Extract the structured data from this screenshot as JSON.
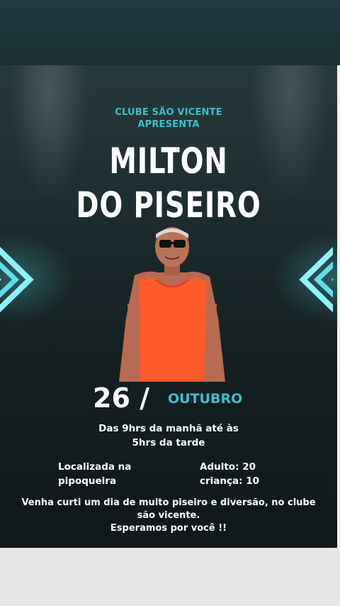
{
  "poster": {
    "presenter_line1": "CLUBE SÃO VICENTE",
    "presenter_line2": "APRESENTA",
    "artist_line1": "MILTON",
    "artist_line2": "DO PISEIRO",
    "date_day": "26 /",
    "date_month": "OUTUBRO",
    "schedule_line1": "Das 9hrs da manhã até às",
    "schedule_line2": "5hrs da tarde",
    "location_line1": "Localizada na",
    "location_line2": "pipoqueira",
    "price_adult": "Adulto: 20",
    "price_child": "criança: 10",
    "invite_line1": "Venha curti um dia de muito piseiro e diversão, no clube",
    "invite_line2": "são vicente.",
    "invite_line3": "Esperamos por você !!"
  },
  "colors": {
    "accent": "#3cc0c8",
    "background": "#152022",
    "shirt": "#ff5a2a"
  }
}
